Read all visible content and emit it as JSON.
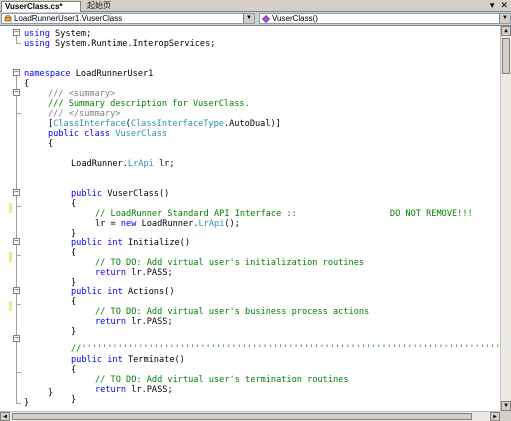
{
  "tabs": {
    "active": "VuserClass.cs*",
    "inactive": "起始页",
    "dropdown_glyph": "▾",
    "close_glyph": "✕"
  },
  "navbar": {
    "class_combo": "LoadRunnerUser1.VuserClass",
    "member_combo": "VuserClass()",
    "class_icon": "class-icon",
    "method_icon": "method-icon",
    "arrow_glyph": "▼"
  },
  "fold_glyphs": {
    "expanded": "−"
  },
  "scroll_glyphs": {
    "up": "▲",
    "down": "▼",
    "left": "◀",
    "right": "▶"
  },
  "code": {
    "l1": {
      "a": "using",
      "b": " System;"
    },
    "l2": {
      "a": "using",
      "b": " System.Runtime.InteropServices;"
    },
    "l5": {
      "a": "namespace",
      "b": " LoadRunnerUser1"
    },
    "l6": "{",
    "l7": {
      "a": "/// ",
      "b": "<summary>"
    },
    "l8": {
      "a": "/// Summary description for VuserClass."
    },
    "l9": {
      "a": "/// ",
      "b": "</summary>"
    },
    "l10": {
      "a": "[",
      "b": "ClassInterface",
      "c": "(",
      "d": "ClassInterfaceType",
      "e": ".AutoDual)]"
    },
    "l11": {
      "a": "public",
      "b": " ",
      "c": "class",
      "d": " ",
      "e": "VuserClass"
    },
    "l12": "{",
    "l13": {
      "a": "LoadRunner.",
      "b": "LrApi",
      "c": " lr;"
    },
    "l15": {
      "a": "public",
      "b": " VuserClass()"
    },
    "l16": "{",
    "l17": {
      "a": "// LoadRunner Standard API Interface ::                  DO NOT REMOVE!!!"
    },
    "l18": {
      "a": "lr = ",
      "b": "new",
      "c": " LoadRunner.",
      "d": "LrApi",
      "e": "();"
    },
    "l19": "}",
    "l20": {
      "a": "public",
      "b": " ",
      "c": "int",
      "d": " Initialize()"
    },
    "l21": "{",
    "l22": {
      "a": "// TO DO: Add virtual user's initialization routines"
    },
    "l23": {
      "a": "return",
      "b": " lr.PASS;"
    },
    "l24": "}",
    "l25": {
      "a": "public",
      "b": " ",
      "c": "int",
      "d": " Actions()"
    },
    "l26": "{",
    "l27": {
      "a": "// TO DO: Add virtual user's business process actions"
    },
    "l28": {
      "a": "return",
      "b": " lr.PASS;"
    },
    "l29": "}",
    "l31": {
      "a": "//''''''''''''''''''''''''''''''''''''''''''''''''''''''''''''''''''''''''''''''''''''''''''''''''''''"
    },
    "l32": {
      "a": "public",
      "b": " ",
      "c": "int",
      "d": " Terminate()"
    },
    "l33": "{",
    "l34": {
      "a": "// TO DO: Add virtual user's termination routines"
    },
    "l35": {
      "a": "return",
      "b": " lr.PASS;"
    },
    "l36": "}",
    "l38": "}",
    "l39": "}"
  }
}
